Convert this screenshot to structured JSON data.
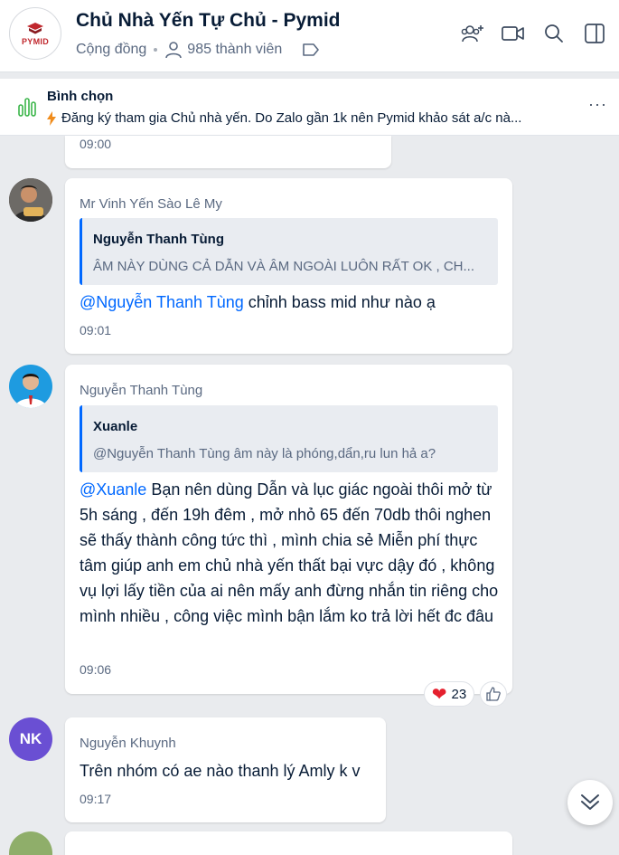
{
  "header": {
    "group_logo_text": "PYMID",
    "title": "Chủ Nhà Yến Tự Chủ - Pymid",
    "category": "Cộng đồng",
    "member_count": "985 thành viên",
    "icons": [
      "add-member-icon",
      "video-call-icon",
      "search-icon",
      "sidebar-toggle-icon"
    ]
  },
  "poll": {
    "label": "Bình chọn",
    "description": "Đăng ký tham gia Chủ nhà yến. Do Zalo gần 1k nên Pymid khảo sát a/c nà...",
    "more": "···",
    "accent": "#3bb54a"
  },
  "messages": [
    {
      "time": "09:00"
    },
    {
      "sender": "Mr Vinh Yến Sào Lê My",
      "quote": {
        "name": "Nguyễn Thanh Tùng",
        "text": "ÂM NÀY DÙNG CẢ DẪN VÀ ÂM NGOÀI LUÔN RẤT OK , CH..."
      },
      "mention": "@Nguyễn Thanh Tùng",
      "text": " chỉnh bass mid như nào ạ",
      "time": "09:01"
    },
    {
      "sender": "Nguyễn Thanh Tùng",
      "quote": {
        "name": "Xuanle",
        "text": "@Nguyễn Thanh Tùng âm này là phóng,dẩn,ru lun hả a?"
      },
      "mention": "@Xuanle",
      "text": " Bạn nên dùng Dẫn và lục giác ngoài thôi mở từ 5h sáng , đến 19h đêm , mở nhỏ 65 đến 70db thôi nghen sẽ thấy thành công tức thì , mình chia sẻ Miễn phí thực tâm giúp anh em chủ nhà yến thất bại vực dậy đó , không vụ lợi lấy tiền của ai nên mấy anh đừng nhắn tin riêng cho mình nhiều , công việc mình bận lắm ko trả lời hết đc đâu",
      "time": "09:06",
      "reaction_count": "23"
    },
    {
      "sender": "Nguyễn Khuynh",
      "avatar_initials": "NK",
      "text": "Trên nhóm có ae nào thanh lý Amly k v",
      "time": "09:17"
    }
  ],
  "colors": {
    "mention": "#0068ff",
    "reaction_heart": "#e5202e",
    "avatar_nk": "#6a4fd3"
  }
}
